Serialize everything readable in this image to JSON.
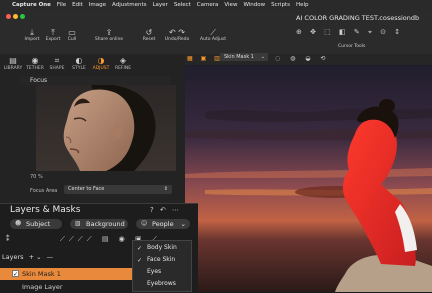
{
  "menubar": {
    "apple_symbol": "",
    "app_name": "Capture One",
    "items": [
      "File",
      "Edit",
      "Image",
      "Adjustments",
      "Layer",
      "Select",
      "Camera",
      "View",
      "Window",
      "Scripts",
      "Help"
    ]
  },
  "window": {
    "title": "AI COLOR GRADING TEST.cosessiondb"
  },
  "toolbar": {
    "import": "Import",
    "export": "Export",
    "cull": "Cull",
    "share_online": "Share online",
    "reset": "Reset",
    "undo_redo": "Undo/Redo",
    "auto_adjust": "Auto Adjust",
    "cursor_tools": "Cursor Tools"
  },
  "tool_tabs": [
    {
      "label": "LIBRARY",
      "icon": "library-icon"
    },
    {
      "label": "TETHER",
      "icon": "camera-icon"
    },
    {
      "label": "SHAPE",
      "icon": "crop-icon"
    },
    {
      "label": "STYLE",
      "icon": "palette-icon"
    },
    {
      "label": "ADJUST",
      "icon": "adjust-icon"
    },
    {
      "label": "REFINE",
      "icon": "refine-icon"
    }
  ],
  "active_tab": "ADJUST",
  "focus": {
    "title": "Focus",
    "zoom": "70 %",
    "area_label": "Focus Area",
    "area_value": "Center to Face"
  },
  "viewer": {
    "layer_select": "Skin Mask 1"
  },
  "layers_masks": {
    "title": "Layers & Masks",
    "buttons": [
      "Subject",
      "Background",
      "People"
    ],
    "layers_label": "Layers",
    "rows": [
      {
        "label": "Skin Mask 1",
        "checked": true,
        "selected": true
      },
      {
        "label": "Image Layer",
        "checked": false,
        "selected": false
      }
    ]
  },
  "people_menu": {
    "items": [
      {
        "label": "Body Skin",
        "checked": true
      },
      {
        "label": "Face Skin",
        "checked": true
      },
      {
        "label": "Eyes",
        "checked": false
      },
      {
        "label": "Eyebrows",
        "checked": false
      }
    ]
  },
  "colors": {
    "accent": "#ff9b2b",
    "mask_overlay": "#e8272a",
    "selected_row": "#e8893b"
  }
}
